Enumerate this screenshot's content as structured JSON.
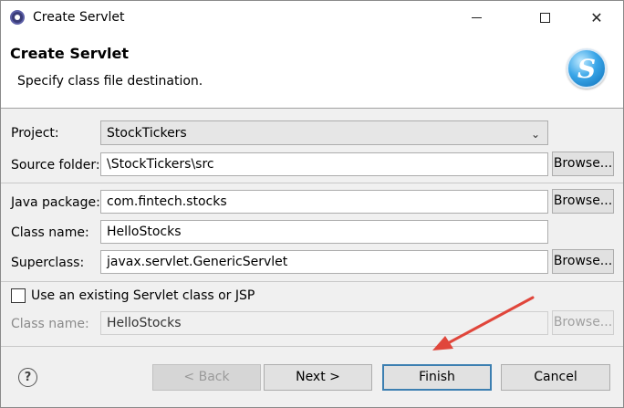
{
  "window": {
    "title": "Create Servlet"
  },
  "header": {
    "title": "Create Servlet",
    "description": "Specify class file destination.",
    "logo_letter": "S"
  },
  "form": {
    "project": {
      "label": "Project:",
      "value": "StockTickers"
    },
    "source_folder": {
      "label": "Source folder:",
      "value": "\\StockTickers\\src",
      "browse": "Browse..."
    },
    "java_package": {
      "label": "Java package:",
      "value": "com.fintech.stocks",
      "browse": "Browse..."
    },
    "class_name": {
      "label": "Class name:",
      "value": "HelloStocks"
    },
    "superclass": {
      "label": "Superclass:",
      "value": "javax.servlet.GenericServlet",
      "browse": "Browse..."
    },
    "use_existing": {
      "label": "Use an existing Servlet class or JSP",
      "checked": false
    },
    "existing_class_name": {
      "label": "Class name:",
      "value": "HelloStocks",
      "browse": "Browse...",
      "disabled": true
    }
  },
  "footer": {
    "help_icon": "help-icon",
    "back": "< Back",
    "next": "Next >",
    "finish": "Finish",
    "cancel": "Cancel"
  },
  "annotation": {
    "arrow_color": "#e0463b"
  }
}
